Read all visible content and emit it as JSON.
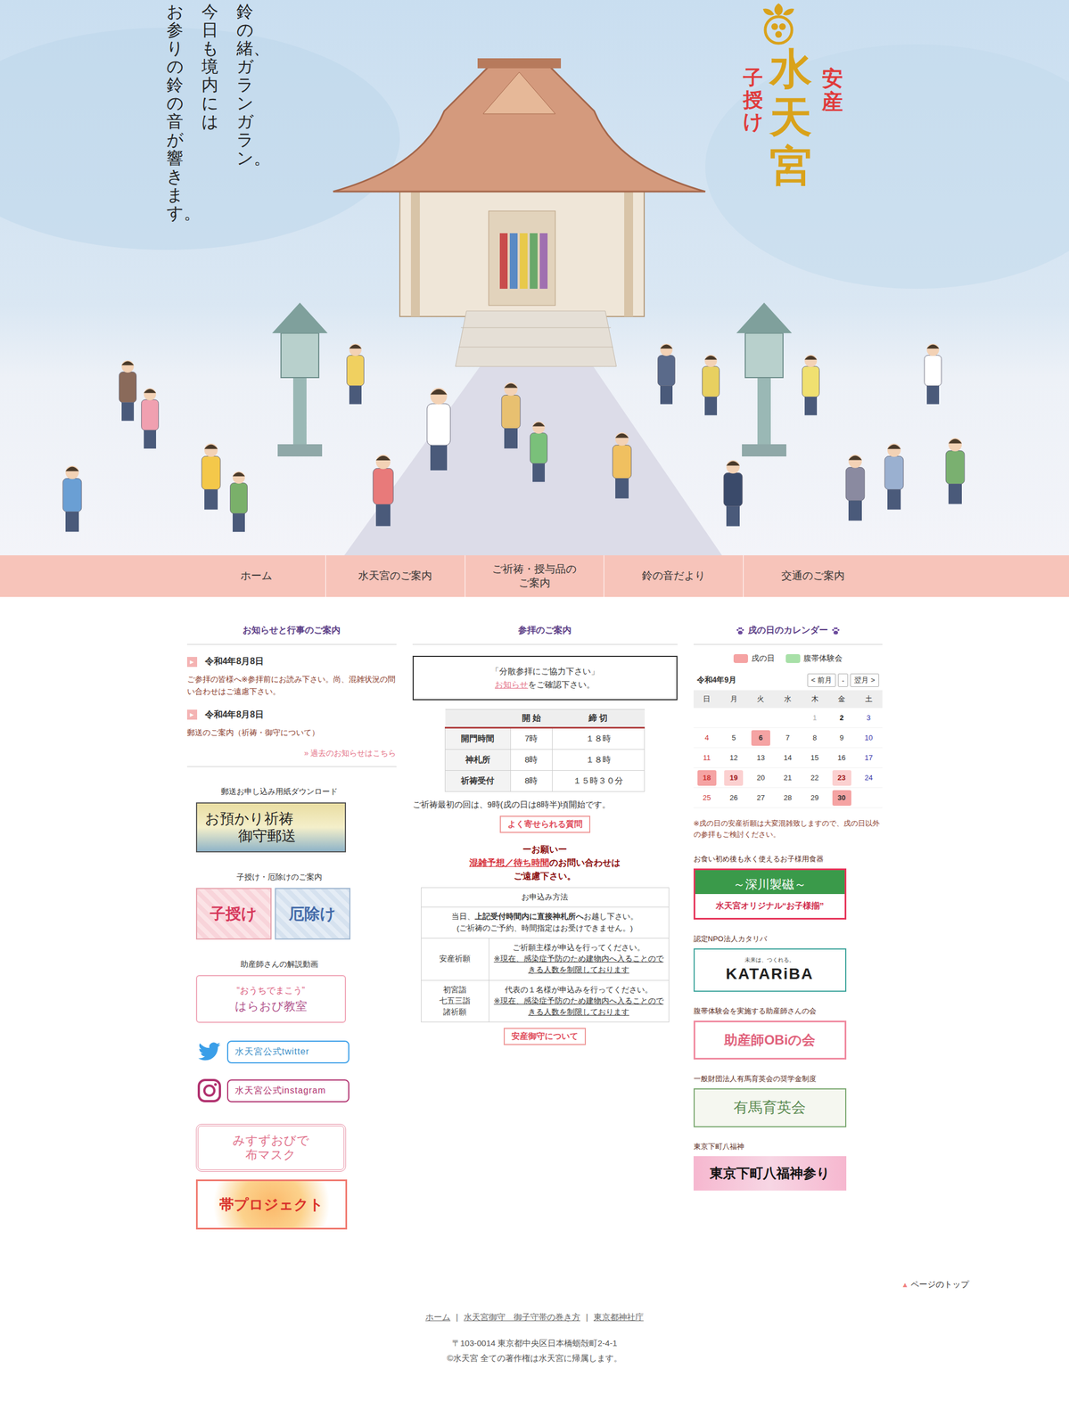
{
  "hero": {
    "copy": [
      "鈴の緒、ガランガラン。",
      "今日も境内には",
      "お参りの鈴の音が響きます。"
    ],
    "logo": {
      "sub_left": "子授け",
      "name": "水天宮",
      "sub_right": "安産"
    }
  },
  "nav": [
    {
      "label": "ホーム"
    },
    {
      "label": "水天宮のご案内"
    },
    {
      "label": "ご祈祷・授与品のご案内"
    },
    {
      "label": "鈴の音だより"
    },
    {
      "label": "交通のご案内"
    }
  ],
  "news": {
    "heading": "お知らせと行事のご案内",
    "items": [
      {
        "icon": "▶",
        "date": "令和4年8月8日",
        "text": "ご参拝の皆様へ※参拝前にお読み下さい。尚、混雑状況の問い合わせはご遠慮下さい。"
      },
      {
        "icon": "▶",
        "date": "令和4年8月8日",
        "text": "郵送のご案内（祈祷・御守について）"
      }
    ],
    "more": "» 過去のお知らせはこちら"
  },
  "left_links": [
    {
      "label": "郵送お申し込み用紙ダウンロード",
      "banners": [
        {
          "kind": "mail",
          "lines": [
            "お預かり祈祷",
            "御守郵送"
          ]
        }
      ]
    },
    {
      "label": "子授け・厄除けのご案内",
      "banners": [
        {
          "kind": "kodakara",
          "lines": [
            "子授け"
          ]
        },
        {
          "kind": "yakuyoke",
          "lines": [
            "厄除け"
          ]
        }
      ]
    },
    {
      "label": "助産師さんの解説動画",
      "banners": [
        {
          "kind": "haraobi",
          "lines": [
            "“おうちでまこう”",
            "はらおび教室"
          ]
        }
      ]
    }
  ],
  "social": [
    {
      "kind": "twitter",
      "text": "水天宮公式twitter"
    },
    {
      "kind": "instagram",
      "text": "水天宮公式instagram"
    }
  ],
  "extras": [
    {
      "kind": "mask",
      "lines": [
        "みすずおびで",
        "布マスク"
      ]
    },
    {
      "kind": "obi",
      "lines": [
        "帯プロジェクト"
      ]
    }
  ],
  "visit": {
    "heading": "参拝のご案内",
    "notice": {
      "title": "「分散参拝にご協力下さい」",
      "link": "お知らせ",
      "after": "をご確認下さい。"
    },
    "hours": {
      "columns": [
        "",
        "開 始",
        "締 切"
      ],
      "rows": [
        [
          "開門時間",
          "7時",
          "１８時"
        ],
        [
          "神札所",
          "8時",
          "１８時"
        ],
        [
          "祈祷受付",
          "8時",
          "１５時３０分"
        ]
      ]
    },
    "first_prayer": "ご祈祷最初の回は、9時(戌の日は8時半)頃開始です。",
    "faq": "よく寄せられる質問",
    "request": {
      "title": "ーお願いー",
      "link": "混雑予想／待ち時間",
      "after": "のお問い合わせは",
      "last": "ご遠慮下さい。"
    },
    "apply": {
      "title": "お申込み方法",
      "intro": {
        "before": "当日、",
        "bold": "上記受付時間内に直接神札所へ",
        "after": "お越し下さい。",
        "note": "(ご祈祷のご予約、時間指定はお受けできません。)"
      },
      "rows": [
        {
          "label": [
            "安産祈願"
          ],
          "text": "ご祈願主様が申込を行ってください。",
          "note": "※現在、感染症予防のため建物内へ入ることのできる人数を制限しております"
        },
        {
          "label": [
            "初宮詣",
            "七五三詣",
            "諸祈願"
          ],
          "text": "代表の１名様が申込みを行ってください。",
          "note": "※現在、感染症予防のため建物内へ入ることのできる人数を制限しております"
        }
      ]
    },
    "amulet": "安産御守について"
  },
  "calendar": {
    "heading": "戌の日のカレンダー",
    "legend": [
      {
        "label": "戌の日",
        "color": "#f5a3a3"
      },
      {
        "label": "腹帯体験会",
        "color": "#a8e0a8"
      }
    ],
    "title": "令和4年9月",
    "buttons": [
      "< 前月",
      "-",
      "翌月 >"
    ],
    "weekdays": [
      "日",
      "月",
      "火",
      "水",
      "木",
      "金",
      "土"
    ],
    "weeks": [
      [
        {
          "day": "",
          "state": "normal"
        },
        {
          "day": "",
          "state": "normal"
        },
        {
          "day": "",
          "state": "normal"
        },
        {
          "day": "",
          "state": "normal"
        },
        {
          "day": "1",
          "state": "past"
        },
        {
          "day": "2",
          "state": "today"
        },
        {
          "day": "3",
          "state": "normal"
        }
      ],
      [
        {
          "day": "4",
          "state": "normal"
        },
        {
          "day": "5",
          "state": "normal"
        },
        {
          "day": "6",
          "state": "inu"
        },
        {
          "day": "7",
          "state": "normal"
        },
        {
          "day": "8",
          "state": "normal"
        },
        {
          "day": "9",
          "state": "normal"
        },
        {
          "day": "10",
          "state": "normal"
        }
      ],
      [
        {
          "day": "11",
          "state": "normal"
        },
        {
          "day": "12",
          "state": "normal"
        },
        {
          "day": "13",
          "state": "normal"
        },
        {
          "day": "14",
          "state": "normal"
        },
        {
          "day": "15",
          "state": "normal"
        },
        {
          "day": "16",
          "state": "normal"
        },
        {
          "day": "17",
          "state": "normal"
        }
      ],
      [
        {
          "day": "18",
          "state": "inu"
        },
        {
          "day": "19",
          "state": "holiday"
        },
        {
          "day": "20",
          "state": "normal"
        },
        {
          "day": "21",
          "state": "normal"
        },
        {
          "day": "22",
          "state": "normal"
        },
        {
          "day": "23",
          "state": "holiday"
        },
        {
          "day": "24",
          "state": "normal"
        }
      ],
      [
        {
          "day": "25",
          "state": "normal"
        },
        {
          "day": "26",
          "state": "normal"
        },
        {
          "day": "27",
          "state": "normal"
        },
        {
          "day": "28",
          "state": "normal"
        },
        {
          "day": "29",
          "state": "normal"
        },
        {
          "day": "30",
          "state": "inu"
        },
        {
          "day": "",
          "state": "normal"
        }
      ]
    ],
    "note": "※戌の日の安産祈願は大変混雑致しますので、戌の日以外の参拝もご検討ください。"
  },
  "sponsors": [
    {
      "label": "お食い初め後も永く使えるお子様用食器",
      "banner": {
        "kind": "fukagawa",
        "lines": [
          "～深川製磁～",
          "水天宮オリジナル“お子様揃”"
        ]
      }
    },
    {
      "label": "認定NPO法人カタリバ",
      "banner": {
        "kind": "katariba",
        "lines": [
          "未来は、つくれる。",
          "KATARiBA"
        ]
      }
    },
    {
      "label": "腹帯体験会を実施する助産師さんの会",
      "banner": {
        "kind": "obinokai",
        "lines": [
          "助産師OBiの会"
        ]
      }
    },
    {
      "label": "一般財団法人有馬育英会の奨学金制度",
      "banner": {
        "kind": "arima",
        "lines": [
          "有馬育英会"
        ]
      }
    },
    {
      "label": "東京下町八福神",
      "banner": {
        "kind": "hachifuku",
        "lines": [
          "東京下町八福神参り"
        ]
      }
    }
  ],
  "footer": {
    "page_top": {
      "icon": "▲",
      "label": "ページのトップ"
    },
    "links": [
      "ホーム",
      "水天宮御守　御子守帯の巻き方",
      "東京都神社庁"
    ],
    "separator": "|",
    "address": "〒103-0014 東京都中央区日本橋蛎殻町2-4-1",
    "copyright": "©水天宮 全ての著作権は水天宮に帰属します。"
  }
}
